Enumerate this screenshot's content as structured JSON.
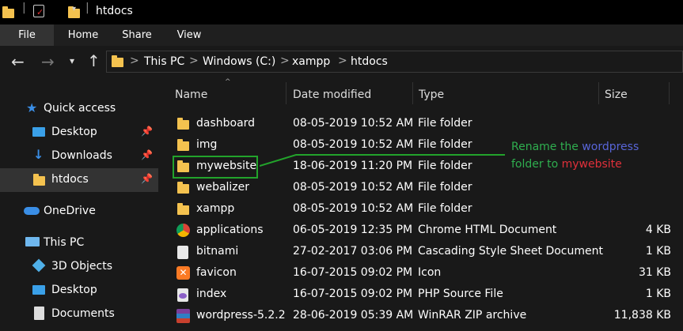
{
  "title_bar": {
    "title": "htdocs",
    "quick_toolbar_icons": [
      "folder-icon",
      "properties-icon",
      "new-folder-icon",
      "dropdown-icon"
    ]
  },
  "ribbon": {
    "tabs": [
      "File",
      "Home",
      "Share",
      "View"
    ],
    "active": "File"
  },
  "address": {
    "breadcrumb": [
      "This PC",
      "Windows (C:)",
      "xampp",
      "htdocs"
    ],
    "separator": ">"
  },
  "sidebar": {
    "items": [
      {
        "label": "Quick access",
        "icon": "star-icon",
        "pinned": false
      },
      {
        "label": "Desktop",
        "icon": "desktop-icon",
        "pinned": true
      },
      {
        "label": "Downloads",
        "icon": "download-icon",
        "pinned": true
      },
      {
        "label": "htdocs",
        "icon": "folder-icon",
        "pinned": true,
        "selected": true
      },
      {
        "label": "OneDrive",
        "icon": "cloud-icon",
        "pinned": false
      },
      {
        "label": "This PC",
        "icon": "computer-icon",
        "pinned": false
      },
      {
        "label": "3D Objects",
        "icon": "cube-icon",
        "pinned": false
      },
      {
        "label": "Desktop",
        "icon": "desktop-icon",
        "pinned": false
      },
      {
        "label": "Documents",
        "icon": "documents-icon",
        "pinned": false
      }
    ]
  },
  "columns": {
    "name": "Name",
    "date": "Date modified",
    "type": "Type",
    "size": "Size"
  },
  "files": [
    {
      "name": "dashboard",
      "date": "08-05-2019 10:52 AM",
      "type": "File folder",
      "size": "",
      "icon": "folder-icon"
    },
    {
      "name": "img",
      "date": "08-05-2019 10:52 AM",
      "type": "File folder",
      "size": "",
      "icon": "folder-icon"
    },
    {
      "name": "mywebsite",
      "date": "18-06-2019 11:20 PM",
      "type": "File folder",
      "size": "",
      "icon": "folder-icon"
    },
    {
      "name": "webalizer",
      "date": "08-05-2019 10:52 AM",
      "type": "File folder",
      "size": "",
      "icon": "folder-icon"
    },
    {
      "name": "xampp",
      "date": "08-05-2019 10:52 AM",
      "type": "File folder",
      "size": "",
      "icon": "folder-icon"
    },
    {
      "name": "applications",
      "date": "06-05-2019 12:35 PM",
      "type": "Chrome HTML Document",
      "size": "4 KB",
      "icon": "chrome-icon"
    },
    {
      "name": "bitnami",
      "date": "27-02-2017 03:06 PM",
      "type": "Cascading Style Sheet Document",
      "size": "1 KB",
      "icon": "css-file-icon"
    },
    {
      "name": "favicon",
      "date": "16-07-2015 09:02 PM",
      "type": "Icon",
      "size": "31 KB",
      "icon": "xampp-icon"
    },
    {
      "name": "index",
      "date": "16-07-2015 09:02 PM",
      "type": "PHP Source File",
      "size": "1 KB",
      "icon": "php-file-icon"
    },
    {
      "name": "wordpress-5.2.2",
      "date": "28-06-2019 05:39 AM",
      "type": "WinRAR ZIP archive",
      "size": "11,838 KB",
      "icon": "winrar-icon"
    }
  ],
  "annotation": {
    "part1": "Rename the ",
    "part2": "wordpress",
    "part3": "folder to ",
    "part4": "mywebsite",
    "colors": {
      "green": "#2fae4f",
      "blue": "#5865d8",
      "red": "#e0303a"
    }
  }
}
